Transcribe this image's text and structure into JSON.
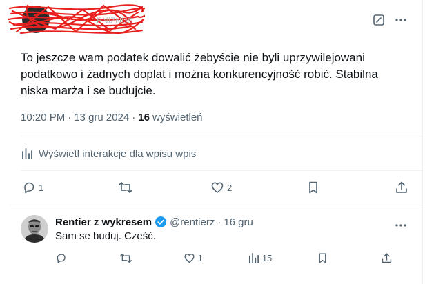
{
  "post": {
    "text": "To jeszcze wam podatek dowalić żebyście nie byli uprzywilejowani podatkowo i żadnych doplat i można konkurencyjność robić. Stabilna niska marża i se budujcie.",
    "time": "10:20 PM",
    "date": "13 gru 2024",
    "views_count": "16",
    "views_label": "wyświetleń",
    "analytics_label": "Wyświetl interakcje dla wpisu wpis",
    "actions": {
      "replies": "1",
      "reposts": "",
      "likes": "2"
    }
  },
  "reply": {
    "name": "Rentier z wykresem",
    "handle": "@rentierz",
    "time": "16 gru",
    "text": "Sam se buduj. Cześć.",
    "actions": {
      "replies": "",
      "reposts": "",
      "likes": "1",
      "views": "15"
    }
  },
  "icons": {
    "header": [
      "grok-icon",
      "more-icon"
    ],
    "actions": [
      "reply-icon",
      "repost-icon",
      "like-icon",
      "bookmark-icon",
      "share-icon"
    ],
    "reply_actions": [
      "reply-icon",
      "repost-icon",
      "like-icon",
      "views-icon",
      "bookmark-icon",
      "share-icon"
    ]
  },
  "colors": {
    "text": "#0f1419",
    "secondary": "#536471",
    "divider": "#eff3f4",
    "verified": "#1d9bf0",
    "redaction": "#e8201e"
  }
}
